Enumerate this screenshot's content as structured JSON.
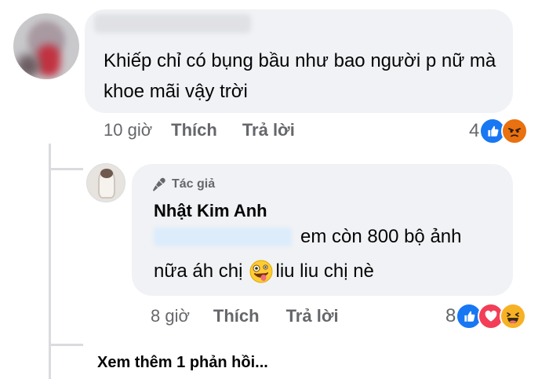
{
  "comment": {
    "text": "Khiếp chỉ có bụng bầu như bao người p nữ mà khoe mãi vậy trời",
    "time": "10 giờ",
    "like_label": "Thích",
    "reply_label": "Trả lời",
    "reaction_count": "4",
    "reactions": [
      "like-icon",
      "angry-icon"
    ]
  },
  "reply": {
    "badge_label": "Tác giả",
    "author": "Nhật Kim Anh",
    "text_line1": "em còn 800 bộ ảnh",
    "text_line2_a": "nữa áh chị",
    "text_line2_emoji": "zany-face-emoji",
    "text_line2_b": "liu liu chị nè",
    "time": "8 giờ",
    "like_label": "Thích",
    "reply_label": "Trả lời",
    "reaction_count": "8",
    "reactions": [
      "like-icon",
      "love-icon",
      "haha-icon"
    ]
  },
  "more_replies": "Xem thêm 1 phản hồi...",
  "colors": {
    "bubble": "#f0f2f5",
    "meta_text": "#65676b",
    "like_blue": "#1877f2",
    "love_red": "#f33e58",
    "angry_orange": "#e9710f",
    "haha_yellow": "#f7b125"
  }
}
